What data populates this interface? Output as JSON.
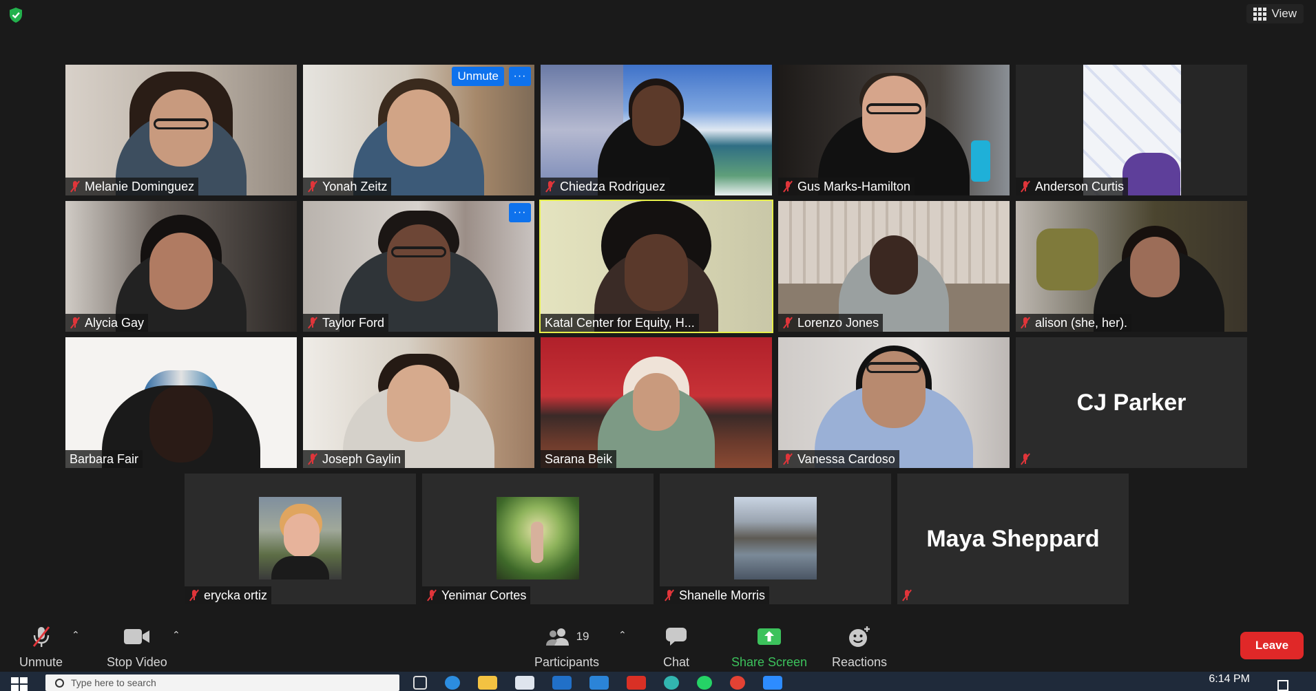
{
  "view_label": "View",
  "tiles": [
    {
      "name": "Melanie Dominguez",
      "muted": true
    },
    {
      "name": "Yonah Zeitz",
      "muted": true
    },
    {
      "name": "Chiedza Rodriguez",
      "muted": true
    },
    {
      "name": "Gus Marks-Hamilton",
      "muted": true
    },
    {
      "name": "Anderson Curtis",
      "muted": true
    },
    {
      "name": "Alycia Gay",
      "muted": true
    },
    {
      "name": "Taylor Ford",
      "muted": true
    },
    {
      "name": "Katal Center for Equity, H...",
      "muted": false,
      "active_speaker": true
    },
    {
      "name": "Lorenzo Jones",
      "muted": true
    },
    {
      "name": "alison (she, her).",
      "muted": true
    },
    {
      "name": "Barbara Fair",
      "muted": false
    },
    {
      "name": "Joseph Gaylin",
      "muted": true
    },
    {
      "name": "Sarana Beik",
      "muted": false
    },
    {
      "name": "Vanessa Cardoso",
      "muted": true
    },
    {
      "name": "CJ Parker",
      "muted": true,
      "video_off": true
    },
    {
      "name": "erycka ortiz",
      "muted": true
    },
    {
      "name": "Yenimar Cortes",
      "muted": true
    },
    {
      "name": "Shanelle Morris",
      "muted": true
    },
    {
      "name": "Maya Sheppard",
      "muted": true,
      "video_off": true
    }
  ],
  "hover_controls": {
    "unmute_label": "Unmute",
    "more_label": "···"
  },
  "toolbar": {
    "unmute_label": "Unmute",
    "stop_video_label": "Stop Video",
    "participants_label": "Participants",
    "participants_count": "19",
    "chat_label": "Chat",
    "share_screen_label": "Share Screen",
    "reactions_label": "Reactions",
    "leave_label": "Leave"
  },
  "taskbar": {
    "search_placeholder": "Type here to search",
    "clock": "6:14 PM"
  },
  "colors": {
    "accent_blue": "#0e72ed",
    "leave_red": "#e02828",
    "share_green": "#3cc25c",
    "muted_red": "#e0353a",
    "active_speaker_outline": "#e7f04b"
  }
}
